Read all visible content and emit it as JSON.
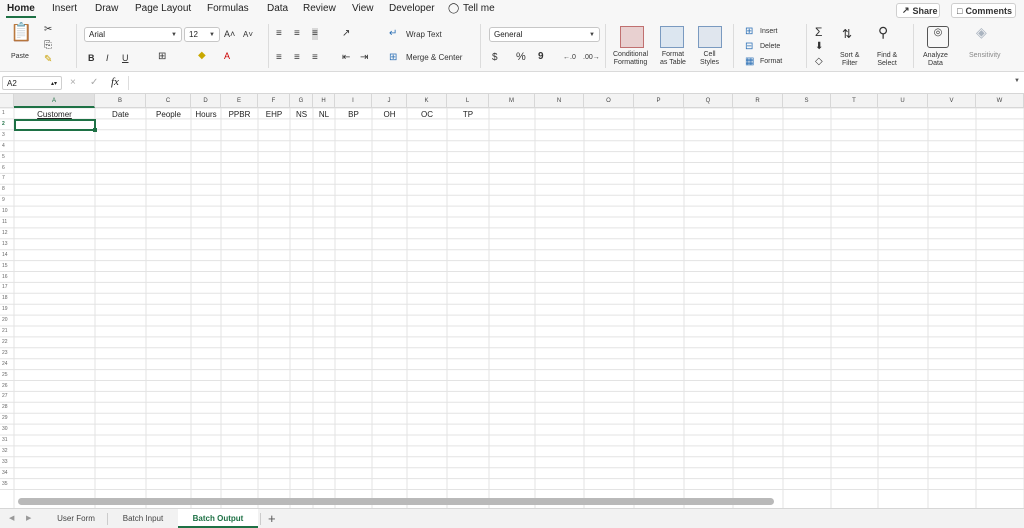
{
  "menu": {
    "tabs": [
      "Home",
      "Insert",
      "Draw",
      "Page Layout",
      "Formulas",
      "Data",
      "Review",
      "View",
      "Developer"
    ],
    "tell_me": "Tell me",
    "share_label": "Share",
    "comments_label": "Comments"
  },
  "ribbon": {
    "paste_label": "Paste",
    "font_name": "Arial",
    "font_size": "12",
    "bold": "B",
    "italic": "I",
    "underline": "U",
    "wrap_text": "Wrap Text",
    "merge_center": "Merge & Center",
    "number_format": "General",
    "currency": "$",
    "percent": "%",
    "comma": "9",
    "conditional_formatting": "Conditional\nFormatting",
    "format_as_table": "Format\nas Table",
    "cell_styles": "Cell\nStyles",
    "insert": "Insert",
    "delete": "Delete",
    "format": "Format",
    "sort_filter": "Sort &\nFilter",
    "find_select": "Find &\nSelect",
    "analyze_data": "Analyze\nData",
    "sensitivity": "Sensitivity"
  },
  "formula_bar": {
    "name_box": "A2",
    "fx": "fx",
    "cancel": "×",
    "enter": "✓",
    "content": ""
  },
  "grid": {
    "columns": [
      "A",
      "B",
      "C",
      "D",
      "E",
      "F",
      "G",
      "H",
      "I",
      "J",
      "K",
      "L",
      "M",
      "N",
      "O",
      "P",
      "Q",
      "R",
      "S",
      "T",
      "U",
      "V",
      "W"
    ],
    "rows": [
      "1",
      "2",
      "3",
      "4",
      "5",
      "6",
      "7",
      "8",
      "9",
      "10",
      "11",
      "12",
      "13",
      "14",
      "15",
      "16",
      "17",
      "18",
      "19",
      "20",
      "21",
      "22",
      "23",
      "24",
      "25",
      "26",
      "27",
      "28",
      "29",
      "30",
      "31",
      "32",
      "33",
      "34",
      "35"
    ],
    "row1_values": [
      "Customer",
      "Date",
      "People",
      "Hours",
      "PPBR",
      "EHP",
      "NS",
      "NL",
      "BP",
      "OH",
      "OC",
      "TP"
    ],
    "selected_cell": "A2"
  },
  "sheets": {
    "tabs": [
      "User Form",
      "Batch Input",
      "Batch Output"
    ],
    "active": "Batch Output",
    "add": "+"
  },
  "colors": {
    "accent": "#1e7145",
    "ribbon_bg": "#f7f7f7",
    "gridline": "#e3e3e3"
  }
}
